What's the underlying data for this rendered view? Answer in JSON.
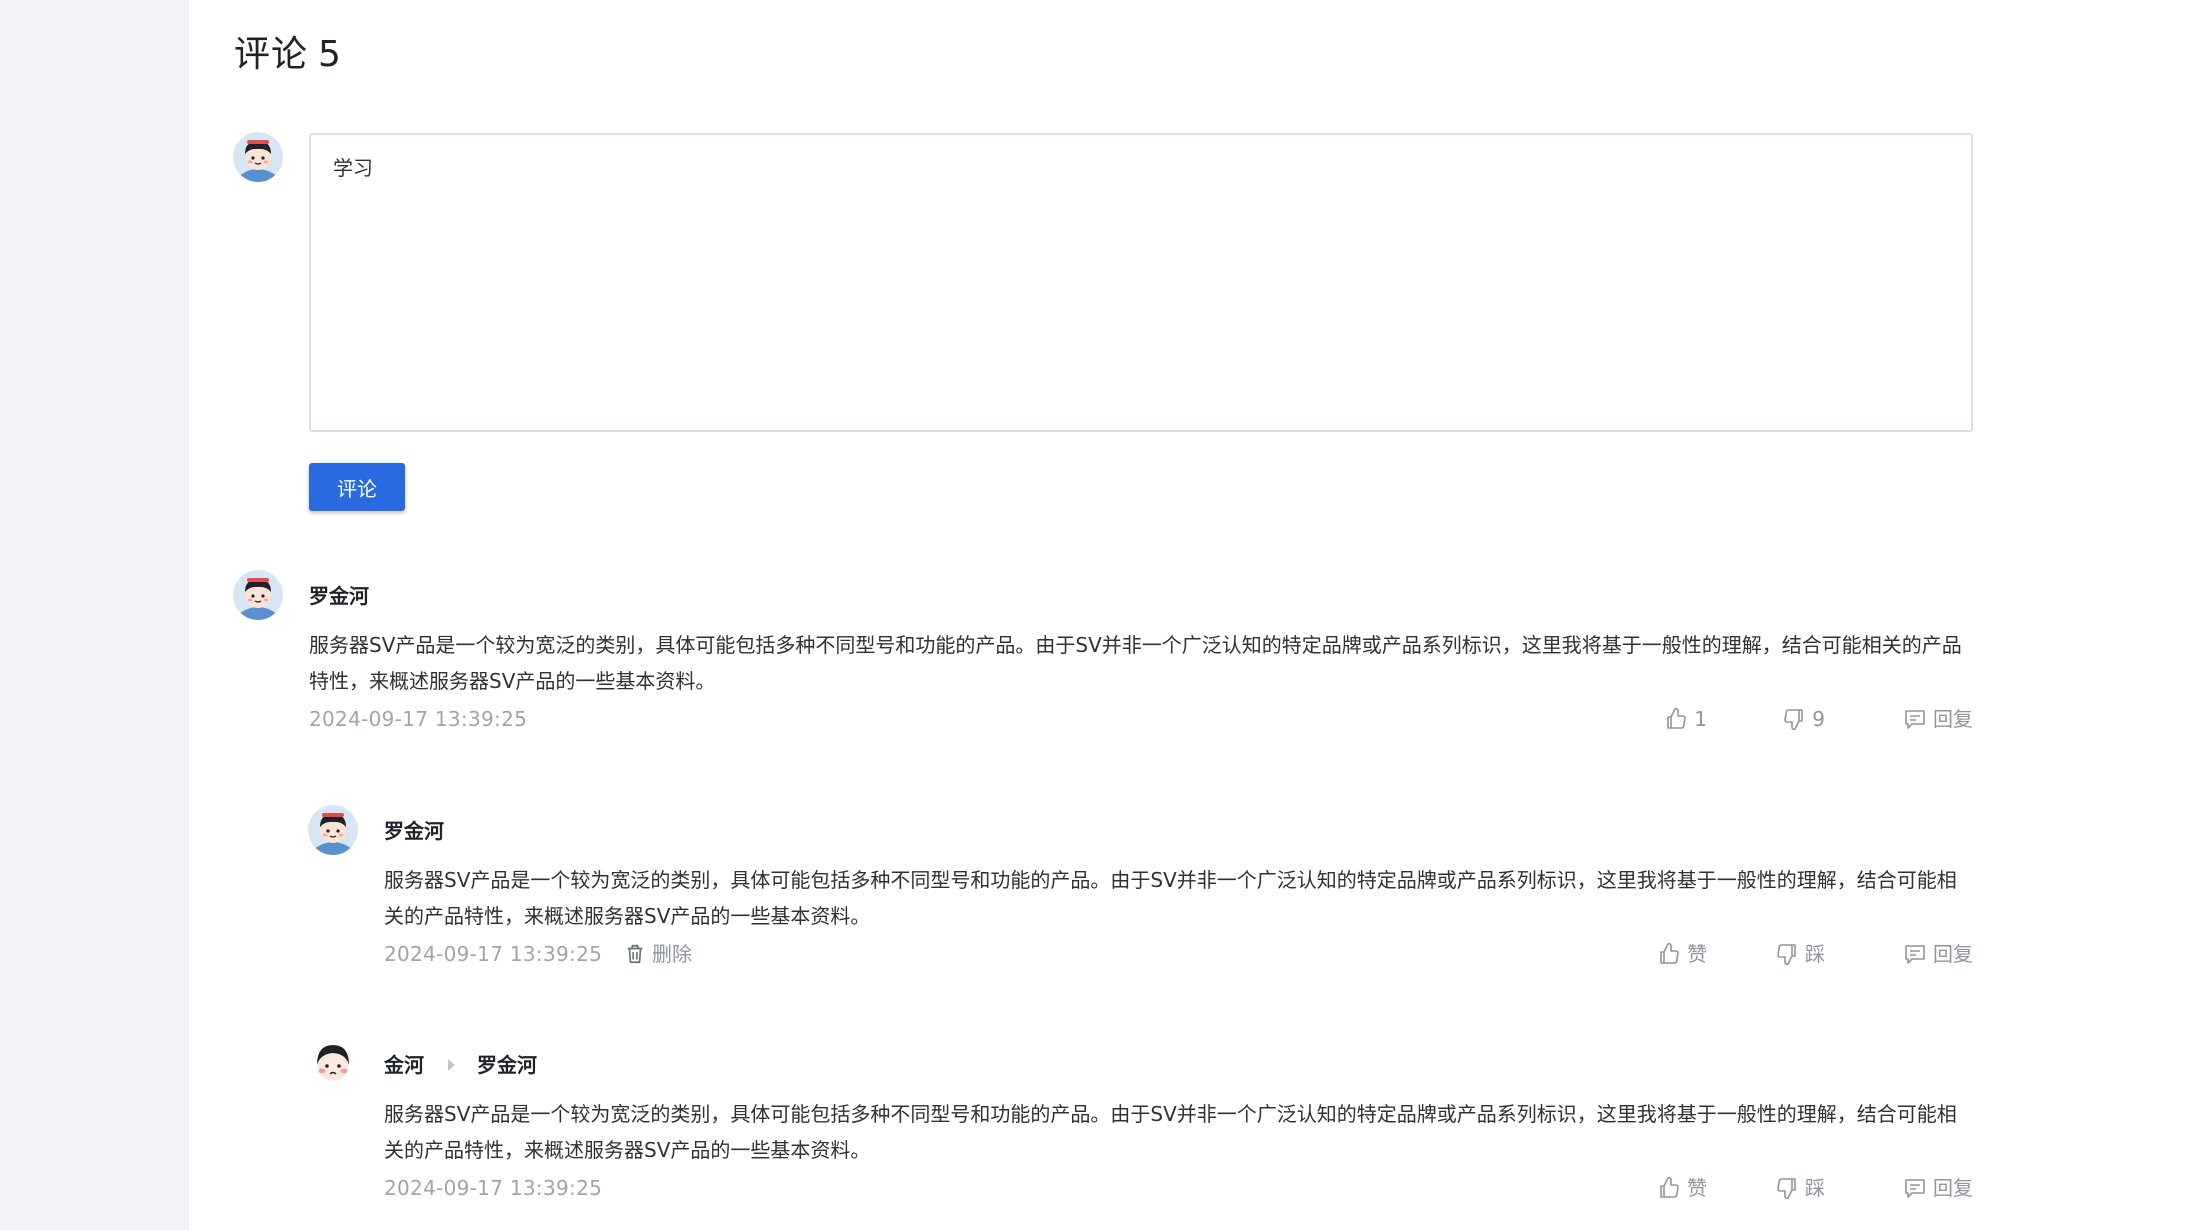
{
  "section": {
    "title": "评论",
    "count": "5"
  },
  "editor": {
    "value": "学习",
    "submit_label": "评论"
  },
  "comments": [
    {
      "author": "罗金河",
      "content": "服务器SV产品是一个较为宽泛的类别，具体可能包括多种不同型号和功能的产品。由于SV并非一个广泛认知的特定品牌或产品系列标识，这里我将基于一般性的理解，结合可能相关的产品特性，来概述服务器SV产品的一些基本资料。",
      "time": "2024-09-17 13:39:25",
      "like_label": "1",
      "dislike_label": "9",
      "reply_label": "回复"
    },
    {
      "author": "罗金河",
      "content": "服务器SV产品是一个较为宽泛的类别，具体可能包括多种不同型号和功能的产品。由于SV并非一个广泛认知的特定品牌或产品系列标识，这里我将基于一般性的理解，结合可能相关的产品特性，来概述服务器SV产品的一些基本资料。",
      "time": "2024-09-17 13:39:25",
      "delete_label": "删除",
      "like_label": "赞",
      "dislike_label": "踩",
      "reply_label": "回复"
    },
    {
      "author": "金河",
      "reply_to": "罗金河",
      "content": "服务器SV产品是一个较为宽泛的类别，具体可能包括多种不同型号和功能的产品。由于SV并非一个广泛认知的特定品牌或产品系列标识，这里我将基于一般性的理解，结合可能相关的产品特性，来概述服务器SV产品的一些基本资料。",
      "time": "2024-09-17 13:39:25",
      "like_label": "赞",
      "dislike_label": "踩",
      "reply_label": "回复"
    }
  ],
  "colors": {
    "accent": "#2a6ae0",
    "gutter": "#f2f3f6",
    "text": "#1f2329",
    "muted": "#a0a4ab",
    "border": "#dcdfe6"
  },
  "icons": {
    "like": "thumbs-up-icon",
    "dislike": "thumbs-down-icon",
    "reply": "comment-bubble-icon",
    "delete": "trash-icon",
    "reply_to": "caret-right-icon"
  }
}
